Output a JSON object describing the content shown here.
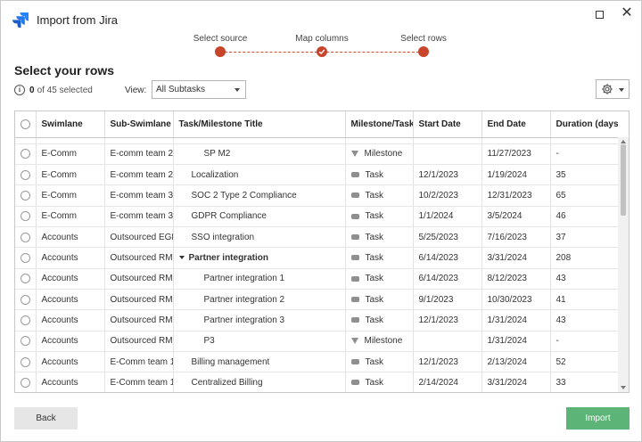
{
  "window": {
    "title": "Import from Jira"
  },
  "stepper": {
    "steps": [
      {
        "label": "Select source",
        "state": "done"
      },
      {
        "label": "Map columns",
        "state": "done-check"
      },
      {
        "label": "Select rows",
        "state": "current"
      }
    ],
    "accent": "#c8442b"
  },
  "header": {
    "title": "Select your rows",
    "selected_count": "0",
    "selected_suffix": "of 45 selected",
    "view_label": "View:",
    "view_value": "All Subtasks"
  },
  "table": {
    "columns": [
      "Swimlane",
      "Sub-Swimlane",
      "Task/Milestone Title",
      "Milestone/Task",
      "Start Date",
      "End Date",
      "Duration (days)"
    ],
    "rows": [
      {
        "swimlane": "E-Comm",
        "sub": "E-comm team 2",
        "title": "SP M2",
        "indent": 2,
        "type": "Milestone",
        "start": "",
        "end": "11/27/2023",
        "duration": "-"
      },
      {
        "swimlane": "E-Comm",
        "sub": "E-comm team 2",
        "title": "Localization",
        "indent": 1,
        "type": "Task",
        "start": "12/1/2023",
        "end": "1/19/2024",
        "duration": "35"
      },
      {
        "swimlane": "E-Comm",
        "sub": "E-comm team 3",
        "title": "SOC 2 Type 2 Compliance",
        "indent": 1,
        "type": "Task",
        "start": "10/2/2023",
        "end": "12/31/2023",
        "duration": "65"
      },
      {
        "swimlane": "E-Comm",
        "sub": "E-comm team 3",
        "title": "GDPR Compliance",
        "indent": 1,
        "type": "Task",
        "start": "1/1/2024",
        "end": "3/5/2024",
        "duration": "46"
      },
      {
        "swimlane": "Accounts",
        "sub": "Outsourced EGL",
        "title": "SSO integration",
        "indent": 1,
        "type": "Task",
        "start": "5/25/2023",
        "end": "7/16/2023",
        "duration": "37"
      },
      {
        "swimlane": "Accounts",
        "sub": "Outsourced RMS",
        "title": "Partner integration",
        "indent": 0,
        "parent": true,
        "type": "Task",
        "start": "6/14/2023",
        "end": "3/31/2024",
        "duration": "208"
      },
      {
        "swimlane": "Accounts",
        "sub": "Outsourced RMS",
        "title": "Partner integration 1",
        "indent": 2,
        "type": "Task",
        "start": "6/14/2023",
        "end": "8/12/2023",
        "duration": "43"
      },
      {
        "swimlane": "Accounts",
        "sub": "Outsourced RMS",
        "title": "Partner integration 2",
        "indent": 2,
        "type": "Task",
        "start": "9/1/2023",
        "end": "10/30/2023",
        "duration": "41"
      },
      {
        "swimlane": "Accounts",
        "sub": "Outsourced RMS",
        "title": "Partner integration 3",
        "indent": 2,
        "type": "Task",
        "start": "12/1/2023",
        "end": "1/31/2024",
        "duration": "43"
      },
      {
        "swimlane": "Accounts",
        "sub": "Outsourced RMS",
        "title": "P3",
        "indent": 2,
        "type": "Milestone",
        "start": "",
        "end": "1/31/2024",
        "duration": "-"
      },
      {
        "swimlane": "Accounts",
        "sub": "E-Comm team 1",
        "title": "Billing management",
        "indent": 1,
        "type": "Task",
        "start": "12/1/2023",
        "end": "2/13/2024",
        "duration": "52"
      },
      {
        "swimlane": "Accounts",
        "sub": "E-Comm team 1",
        "title": "Centralized Billing",
        "indent": 1,
        "type": "Task",
        "start": "2/14/2024",
        "end": "3/31/2024",
        "duration": "33"
      }
    ]
  },
  "footer": {
    "back_label": "Back",
    "import_label": "Import"
  },
  "colors": {
    "import_button": "#5cb577",
    "accent": "#c8442b",
    "jira_blue": "#2684ff"
  }
}
